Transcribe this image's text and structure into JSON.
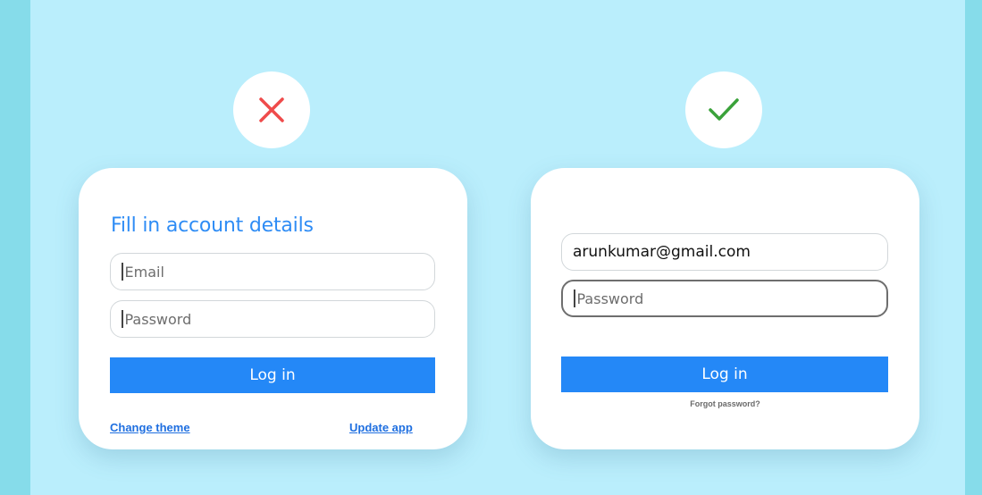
{
  "colors": {
    "outer_bg": "#86dcea",
    "panel_bg": "#baeefc",
    "accent_blue": "#2488f7",
    "title_blue": "#2e8cf5",
    "bad_red": "#ef4b4b",
    "good_green": "#3aa23a"
  },
  "bad_example": {
    "icon": "x-mark-icon",
    "title": "Fill in account details",
    "email_placeholder": "Email",
    "password_placeholder": "Password",
    "login_label": "Log in",
    "change_theme_label": "Change theme",
    "update_app_label": "Update app"
  },
  "good_example": {
    "icon": "check-mark-icon",
    "email_value": "arunkumar@gmail.com",
    "password_placeholder": "Password",
    "login_label": "Log in",
    "forgot_password_label": "Forgot password?"
  }
}
